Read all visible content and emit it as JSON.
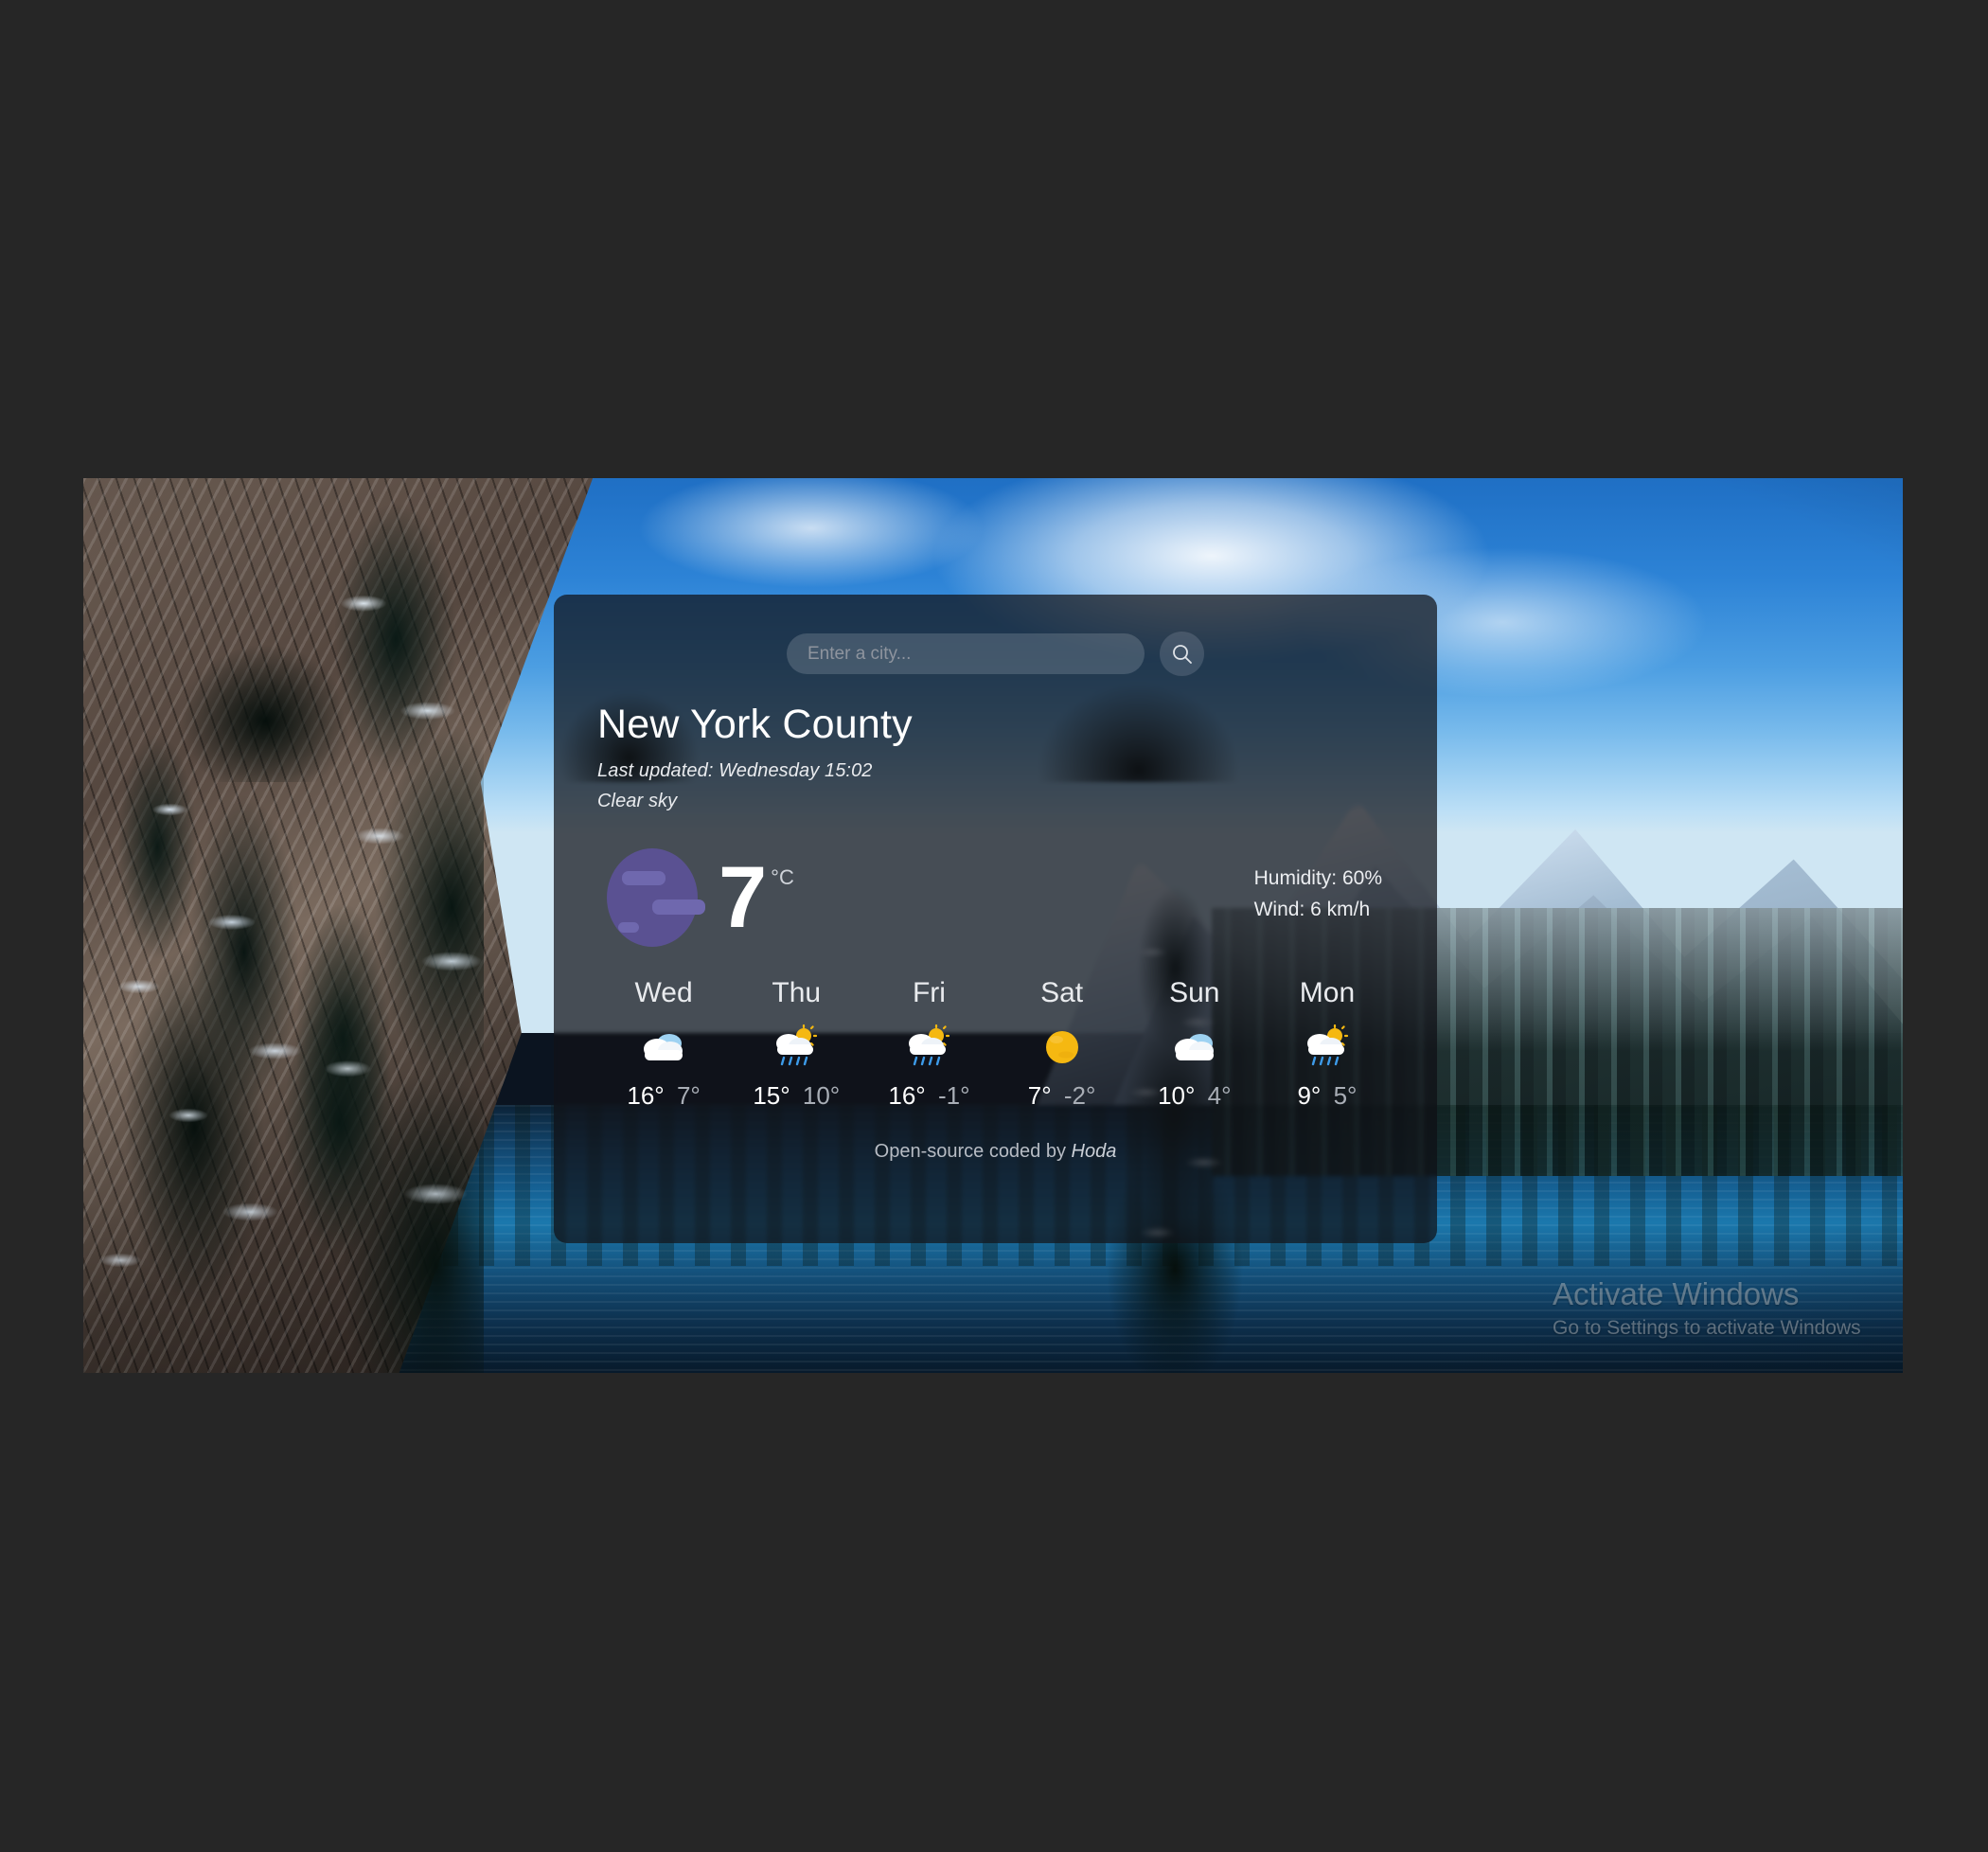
{
  "page": {
    "background_color": "#262626",
    "photo_alt": "snowy-mountain-lake-with-conifers"
  },
  "search": {
    "placeholder": "Enter a city...",
    "value": "",
    "button_icon": "search-icon"
  },
  "location": {
    "city": "New York County",
    "last_updated": "Last updated: Wednesday 15:02",
    "condition": "Clear sky"
  },
  "current": {
    "icon": "broken-image-placeholder-icon",
    "temperature": "7",
    "unit": "°C",
    "humidity": "Humidity: 60%",
    "wind": "Wind: 6 km/h"
  },
  "forecast": {
    "days": [
      {
        "name": "Wed",
        "icon": "cloud-icon",
        "high": "16°",
        "low": "7°"
      },
      {
        "name": "Thu",
        "icon": "sun-rain-cloud-icon",
        "high": "15°",
        "low": "10°"
      },
      {
        "name": "Fri",
        "icon": "sun-rain-cloud-icon",
        "high": "16°",
        "low": "-1°"
      },
      {
        "name": "Sat",
        "icon": "sun-icon",
        "high": "7°",
        "low": "-2°"
      },
      {
        "name": "Sun",
        "icon": "cloud-icon",
        "high": "10°",
        "low": "4°"
      },
      {
        "name": "Mon",
        "icon": "sun-rain-cloud-icon",
        "high": "9°",
        "low": "5°"
      }
    ]
  },
  "footer": {
    "prefix": "Open-source coded by",
    "author": "Hoda"
  },
  "watermark": {
    "title": "Activate Windows",
    "subtitle": "Go to Settings to activate Windows"
  },
  "colors": {
    "card_background": "#101218",
    "accent_purple": "#5a5192",
    "accent_purple_light": "#6f68ae",
    "sun_yellow": "#f5b811",
    "rain_blue": "#3d9be9",
    "text_primary": "#ffffff",
    "text_secondary": "#a9aeb6"
  }
}
